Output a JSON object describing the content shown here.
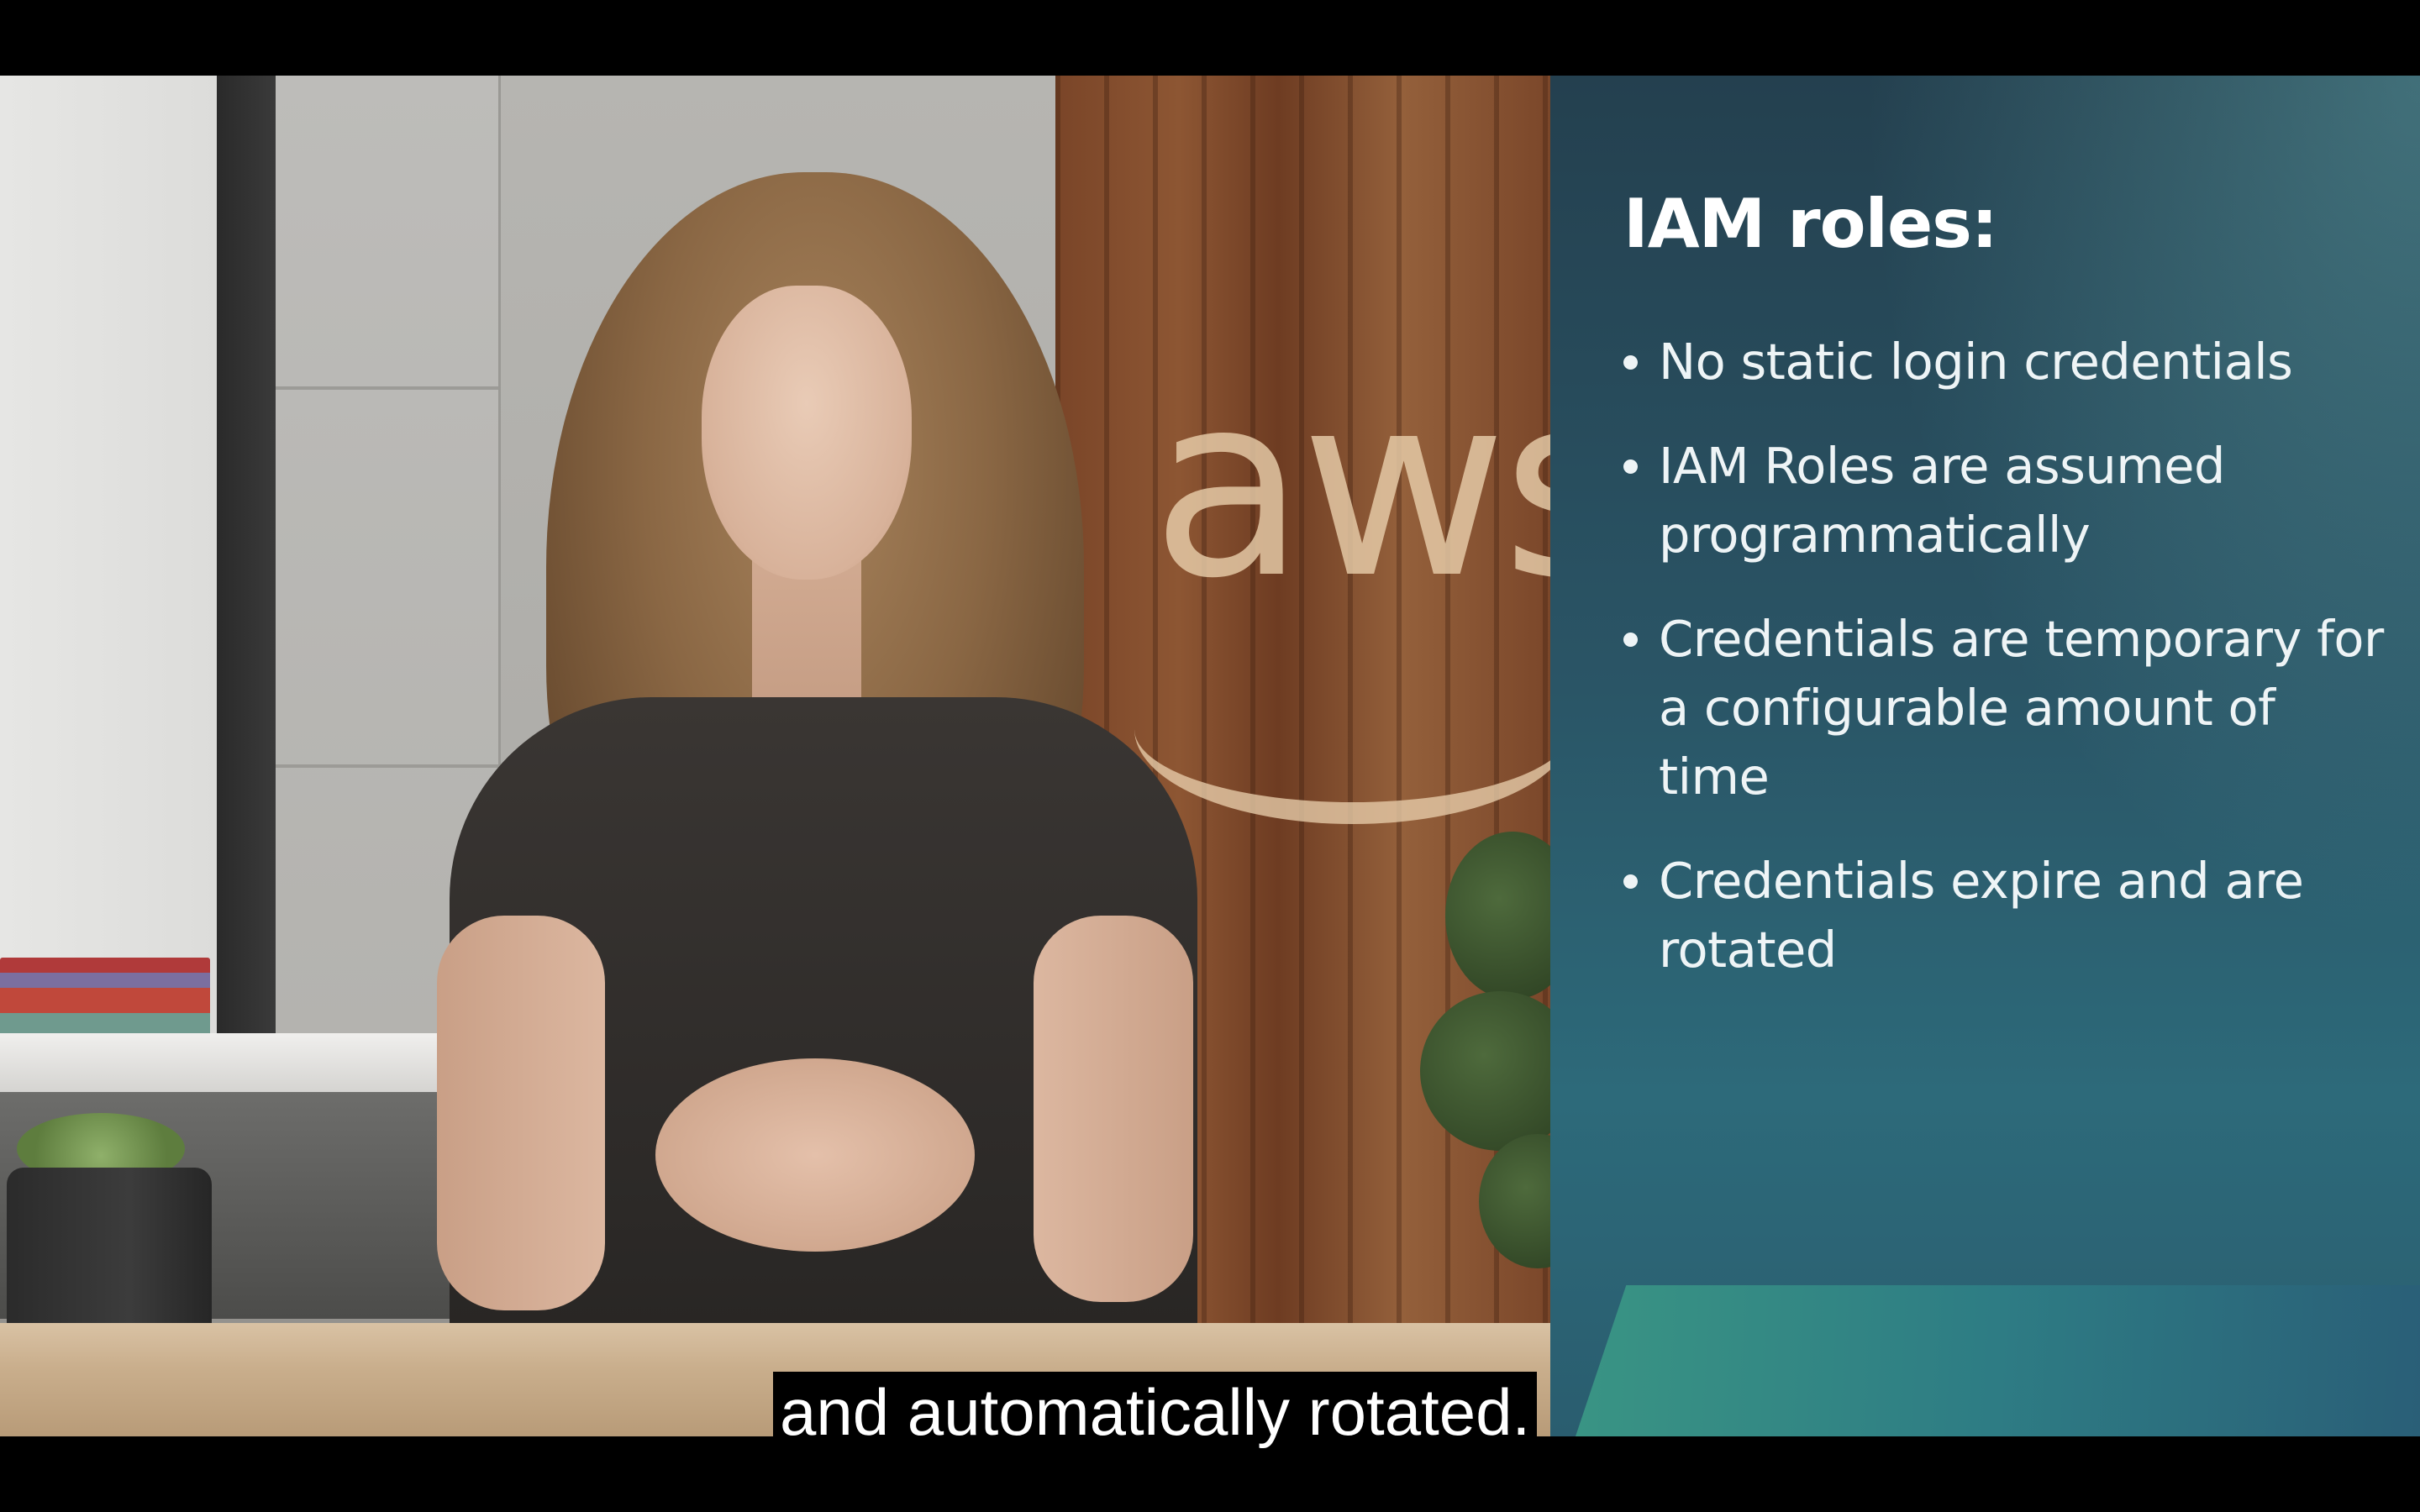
{
  "slide": {
    "title": "IAM roles:",
    "bullets": [
      "No static login credentials",
      "IAM Roles are assumed programmatically",
      "Credentials are temporary for a configurable amount of time",
      "Credentials expire and are rotated"
    ],
    "colors": {
      "background_top": "#24404f",
      "background_bottom": "#2d6a7a",
      "accent": "#3b9a86",
      "text": "#eef4f6"
    }
  },
  "scene": {
    "backdrop_logo": "aws",
    "brand_colors": {
      "wood": "#7a4528",
      "logo_tint": "#e8cdaa"
    }
  },
  "caption": {
    "text": "and automatically rotated."
  }
}
